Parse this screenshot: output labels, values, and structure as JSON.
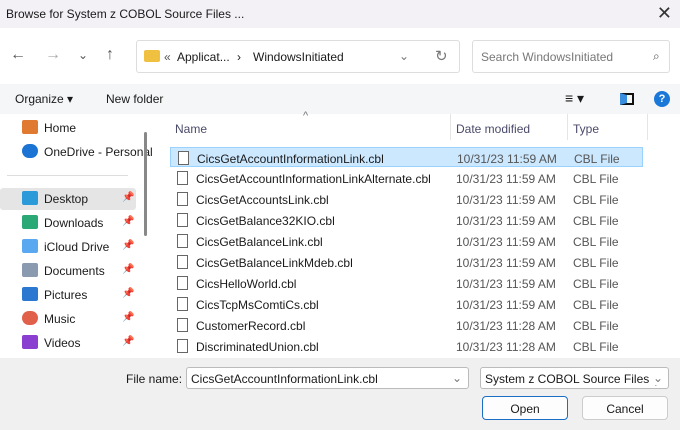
{
  "window": {
    "title": "Browse for System z COBOL Source Files ...",
    "close": "✕"
  },
  "nav": {
    "back": "←",
    "forward": "→",
    "recent": "⌄",
    "up": "↑",
    "breadcrumb_prefix": "«",
    "breadcrumb_parent": "Applicat...",
    "breadcrumb_sep": "›",
    "breadcrumb_current": "WindowsInitiated",
    "dropdown": "⌄",
    "refresh": "↻",
    "search_placeholder": "Search WindowsInitiated"
  },
  "toolbar": {
    "organize": "Organize ▾",
    "new_folder": "New folder",
    "view": "≡ ▾",
    "help": "?"
  },
  "sidebar": {
    "items": [
      {
        "label": "Home",
        "color": "#e07a30"
      },
      {
        "label": "OneDrive - Personal",
        "color": "#1b73d4"
      },
      {
        "label": "Desktop",
        "color": "#2a9bd8",
        "pinned": true
      },
      {
        "label": "Downloads",
        "color": "#2aa876",
        "pinned": true
      },
      {
        "label": "iCloud Drive",
        "color": "#5aa8f0",
        "pinned": true
      },
      {
        "label": "Documents",
        "color": "#8a9bb0",
        "pinned": true
      },
      {
        "label": "Pictures",
        "color": "#2b78d0",
        "pinned": true
      },
      {
        "label": "Music",
        "color": "#e0604a",
        "pinned": true
      },
      {
        "label": "Videos",
        "color": "#8a3fd0",
        "pinned": true
      }
    ]
  },
  "columns": {
    "name": "Name",
    "date": "Date modified",
    "type": "Type",
    "sort": "^"
  },
  "files": [
    {
      "name": "CicsGetAccountInformationLink.cbl",
      "date": "10/31/23 11:59 AM",
      "type": "CBL File"
    },
    {
      "name": "CicsGetAccountInformationLinkAlternate.cbl",
      "date": "10/31/23 11:59 AM",
      "type": "CBL File"
    },
    {
      "name": "CicsGetAccountsLink.cbl",
      "date": "10/31/23 11:59 AM",
      "type": "CBL File"
    },
    {
      "name": "CicsGetBalance32KIO.cbl",
      "date": "10/31/23 11:59 AM",
      "type": "CBL File"
    },
    {
      "name": "CicsGetBalanceLink.cbl",
      "date": "10/31/23 11:59 AM",
      "type": "CBL File"
    },
    {
      "name": "CicsGetBalanceLinkMdeb.cbl",
      "date": "10/31/23 11:59 AM",
      "type": "CBL File"
    },
    {
      "name": "CicsHelloWorld.cbl",
      "date": "10/31/23 11:59 AM",
      "type": "CBL File"
    },
    {
      "name": "CicsTcpMsComtiCs.cbl",
      "date": "10/31/23 11:59 AM",
      "type": "CBL File"
    },
    {
      "name": "CustomerRecord.cbl",
      "date": "10/31/23 11:28 AM",
      "type": "CBL File"
    },
    {
      "name": "DiscriminatedUnion.cbl",
      "date": "10/31/23 11:28 AM",
      "type": "CBL File"
    }
  ],
  "bottom": {
    "filename_label": "File name:",
    "filename_value": "CicsGetAccountInformationLink.cbl",
    "filter": "System z COBOL Source Files (*",
    "open": "Open",
    "cancel": "Cancel",
    "chevron": "⌄"
  }
}
